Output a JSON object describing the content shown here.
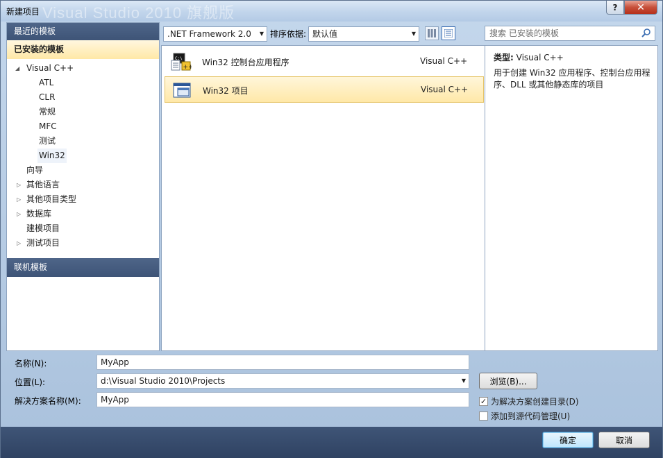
{
  "window": {
    "title": "新建项目",
    "watermark": "Visual Studio 2010 旗舰版",
    "help_glyph": "?",
    "close_glyph": "✕"
  },
  "sidebar": {
    "recent_header": "最近的模板",
    "installed_header": "已安装的模板",
    "online_header": "联机模板",
    "tree": [
      {
        "label": "Visual C++",
        "expanded": true,
        "level": 0
      },
      {
        "label": "ATL",
        "level": 1
      },
      {
        "label": "CLR",
        "level": 1
      },
      {
        "label": "常规",
        "level": 1
      },
      {
        "label": "MFC",
        "level": 1
      },
      {
        "label": "测试",
        "level": 1
      },
      {
        "label": "Win32",
        "level": 1,
        "selected": true
      },
      {
        "label": "向导",
        "level": 0
      },
      {
        "label": "其他语言",
        "level": 0,
        "collapsed": true
      },
      {
        "label": "其他项目类型",
        "level": 0,
        "collapsed": true
      },
      {
        "label": "数据库",
        "level": 0,
        "collapsed": true
      },
      {
        "label": "建模项目",
        "level": 0
      },
      {
        "label": "测试项目",
        "level": 0,
        "collapsed": true
      }
    ]
  },
  "toolbar": {
    "framework_value": ".NET Framework 2.0",
    "sort_label": "排序依据:",
    "sort_value": "默认值",
    "search_placeholder": "搜索 已安装的模板"
  },
  "templates": [
    {
      "name": "Win32 控制台应用程序",
      "lang": "Visual C++",
      "selected": false
    },
    {
      "name": "Win32 项目",
      "lang": "Visual C++",
      "selected": true
    }
  ],
  "description": {
    "type_label": "类型:",
    "type_value": "Visual C++",
    "text": "用于创建 Win32 应用程序、控制台应用程序、DLL 或其他静态库的项目"
  },
  "form": {
    "name_label": "名称(N):",
    "name_value": "MyApp",
    "location_label": "位置(L):",
    "location_value": "d:\\Visual Studio 2010\\Projects",
    "solution_label": "解决方案名称(M):",
    "solution_value": "MyApp",
    "browse_label": "浏览(B)...",
    "create_dir_label": "为解决方案创建目录(D)",
    "create_dir_checked": true,
    "source_control_label": "添加到源代码管理(U)",
    "source_control_checked": false
  },
  "buttons": {
    "ok": "确定",
    "cancel": "取消"
  },
  "colors": {
    "header_dark": "#3e5477",
    "selection": "#ffe8a6"
  }
}
